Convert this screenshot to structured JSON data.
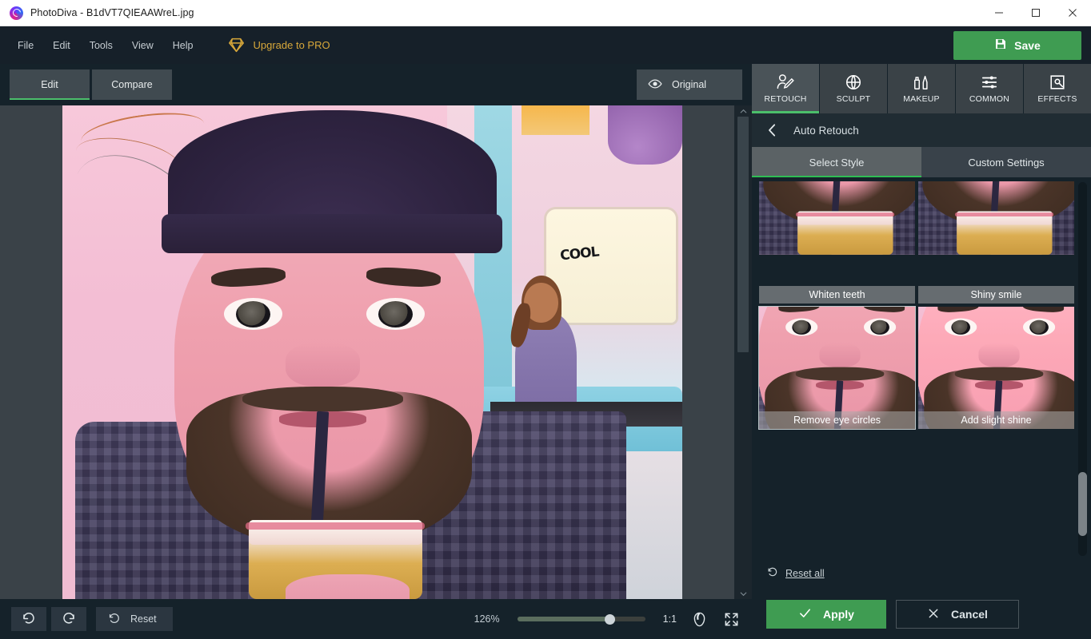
{
  "window": {
    "title": "PhotoDiva - B1dVT7QIEAAWreL.jpg",
    "logo_icon": "photodiva-logo-icon",
    "minimize_icon": "minimize-icon",
    "maximize_icon": "maximize-icon",
    "close_icon": "close-icon"
  },
  "menu": {
    "items": [
      {
        "label": "File"
      },
      {
        "label": "Edit"
      },
      {
        "label": "Tools"
      },
      {
        "label": "View"
      },
      {
        "label": "Help"
      }
    ],
    "upgrade": {
      "label": "Upgrade to PRO",
      "icon": "diamond-icon",
      "color": "#d8a83a"
    },
    "save": {
      "label": "Save",
      "icon": "save-disk-icon",
      "color": "#3f9c52"
    }
  },
  "editor": {
    "tabs": [
      {
        "label": "Edit",
        "active": true
      },
      {
        "label": "Compare",
        "active": false
      }
    ],
    "original_button": {
      "label": "Original",
      "icon": "eye-icon"
    }
  },
  "bottom_bar": {
    "undo": {
      "icon": "undo-arrow-icon"
    },
    "redo": {
      "icon": "redo-arrow-icon"
    },
    "reset": {
      "label": "Reset",
      "icon": "reset-circular-arrow-icon"
    },
    "zoom_percent": "126%",
    "zoom_slider_value": 72,
    "ratio": "1:1",
    "face_fit": {
      "icon": "face-portrait-icon"
    },
    "fit_screen": {
      "icon": "expand-fullscreen-icon"
    }
  },
  "panel": {
    "tabs": [
      {
        "label": "RETOUCH",
        "icon": "retouch-person-pen-icon",
        "active": true
      },
      {
        "label": "SCULPT",
        "icon": "sculpt-globe-icon",
        "active": false
      },
      {
        "label": "MAKEUP",
        "icon": "makeup-lipstick-brush-icon",
        "active": false
      },
      {
        "label": "COMMON",
        "icon": "common-sliders-icon",
        "active": false
      },
      {
        "label": "EFFECTS",
        "icon": "effects-magicwand-icon",
        "active": false
      }
    ],
    "header": {
      "title": "Auto Retouch",
      "back_icon": "chevron-left-icon"
    },
    "sub_tabs": [
      {
        "label": "Select Style",
        "active": true
      },
      {
        "label": "Custom Settings",
        "active": false
      }
    ],
    "styles": [
      {
        "label": "Whiten teeth",
        "selected": false,
        "crop": "crop-mouth"
      },
      {
        "label": "Shiny smile",
        "selected": false,
        "crop": "crop-mouth"
      },
      {
        "label": "Remove eye circles",
        "selected": true,
        "crop": "crop-eyes"
      },
      {
        "label": "Add slight shine",
        "selected": false,
        "crop": "crop-eyes"
      }
    ],
    "reset_all": {
      "label": "Reset all",
      "icon": "reset-circular-arrow-icon"
    },
    "apply": {
      "label": "Apply",
      "icon": "check-icon",
      "color": "#3f9c52"
    },
    "cancel": {
      "label": "Cancel",
      "icon": "x-icon"
    },
    "scrollbar": {
      "orientation": "vertical",
      "position": "near-bottom"
    }
  },
  "canvas": {
    "scrollbar": {
      "orientation": "vertical",
      "up_icon": "chevron-up-icon",
      "down_icon": "chevron-down-icon"
    },
    "photo_alt": "man-in-beanie-drinking-through-straw"
  },
  "poster_text": "COOL"
}
